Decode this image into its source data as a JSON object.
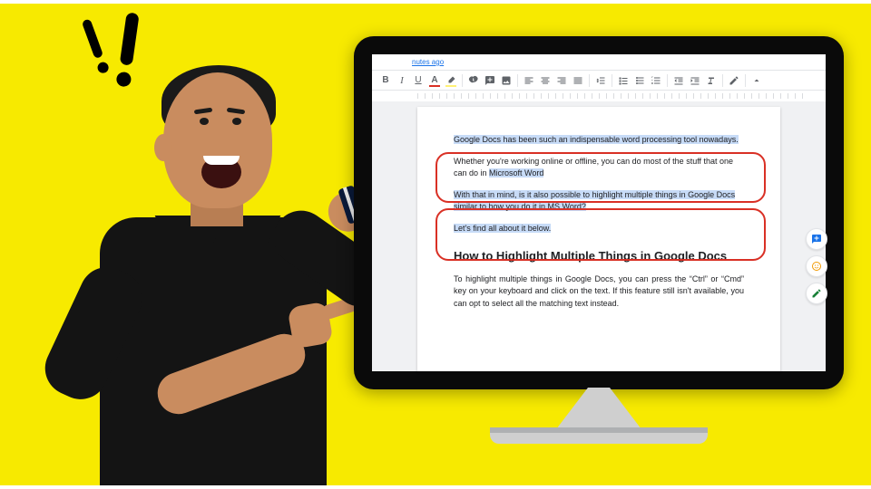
{
  "topstrip_text": "nutes ago",
  "toolbar": {
    "bold": "B",
    "italic": "I",
    "underline": "U"
  },
  "doc": {
    "p1": "Google Docs has been such an indispensable word processing tool nowadays.",
    "p2a": "Whether you're working online or offline, you can do most of the stuff that one can do in ",
    "p2b": "Microsoft Word",
    "p3": "With that in mind, is it also possible to highlight multiple things in Google Docs similar to how you do it in MS Word?",
    "p4": "Let's find all about it below.",
    "heading": "How to Highlight Multiple Things in Google Docs",
    "body": "To highlight multiple things in Google Docs, you can press the “Ctrl” or “Cmd” key on your keyboard and click on the text. If this feature still isn't available, you can opt to select all the matching text instead."
  },
  "side": {
    "comment": "comment",
    "emoji": "emoji",
    "suggest": "suggest"
  }
}
